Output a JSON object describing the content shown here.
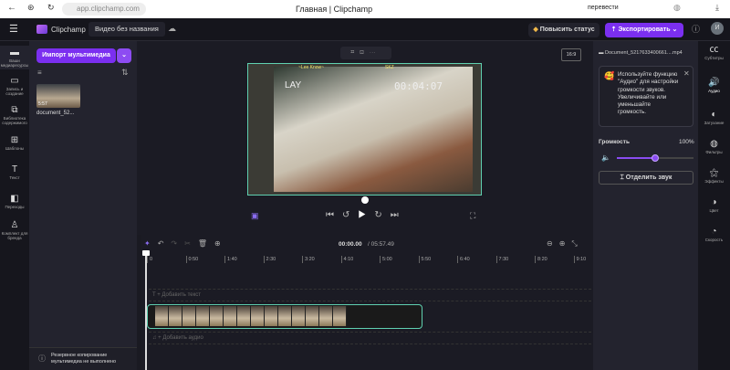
{
  "browser": {
    "url": "app.clipchamp.com",
    "title": "Главная | Clipchamp",
    "translate": "перевести"
  },
  "header": {
    "brand": "Clipchamp",
    "project_name": "Видео без названия",
    "upgrade": "Повысить статус",
    "export": "Экспортировать",
    "avatar": "И"
  },
  "rail": [
    {
      "label": "Ваши медиаресурсы",
      "icon": "folder-icon"
    },
    {
      "label": "Запись и создание",
      "icon": "camera-icon"
    },
    {
      "label": "Библиотека содержимого",
      "icon": "library-icon"
    },
    {
      "label": "Шаблоны",
      "icon": "templates-icon"
    },
    {
      "label": "Текст",
      "icon": "text-icon"
    },
    {
      "label": "Переходы",
      "icon": "transitions-icon"
    },
    {
      "label": "Комплект для бренда",
      "icon": "brand-kit-icon"
    }
  ],
  "media": {
    "import": "Импорт мультимедиа",
    "item_name": "document_52...",
    "item_duration": "5:57",
    "backup": "Резервное копирование мультимедиа не выполнено"
  },
  "preview": {
    "aspect": "16:9",
    "overlay_time": "00:04:07",
    "overlay_tag": "LAY",
    "overlay_top": "~Lee Know~",
    "overlay_brand": "SKZ"
  },
  "right": {
    "filename": "Document_5217633400661....mp4",
    "tip": "Используйте функцию \"Аудио\" для настройки громкости звуков. Увеличивайте или уменьшайте громкость.",
    "volume_label": "Громкость",
    "volume_value": "100%",
    "volume_fraction": 0.5,
    "detach": "Отделить звук"
  },
  "rrail": [
    {
      "label": "Субтитры",
      "icon": "cc-icon"
    },
    {
      "label": "Аудио",
      "icon": "audio-icon"
    },
    {
      "label": "Затухание",
      "icon": "fade-icon"
    },
    {
      "label": "Фильтры",
      "icon": "filters-icon"
    },
    {
      "label": "Эффекты",
      "icon": "effects-icon"
    },
    {
      "label": "Цвет",
      "icon": "color-icon"
    },
    {
      "label": "Скорость",
      "icon": "speed-icon"
    }
  ],
  "timeline": {
    "current": "00:00.00",
    "total": "/ 05:57.49",
    "ticks": [
      "0",
      "0:50",
      "1:40",
      "2:30",
      "3:20",
      "4:10",
      "5:00",
      "5:50",
      "6:40",
      "7:30",
      "8:20",
      "9:10"
    ],
    "add_text": "+ Добавить текст",
    "add_audio": "+ Добавить аудио"
  }
}
